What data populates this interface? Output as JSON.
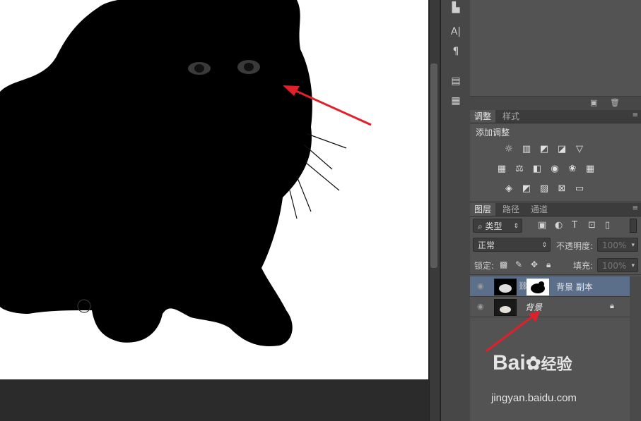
{
  "adjustments_panel": {
    "tabs": [
      "调整",
      "样式"
    ],
    "title": "添加调整"
  },
  "layers_panel": {
    "tabs": [
      "图层",
      "路径",
      "通道"
    ],
    "filter_kind": "类型",
    "blend_mode": "正常",
    "opacity_label": "不透明度:",
    "opacity_value": "100%",
    "lock_label": "锁定:",
    "fill_label": "填充:",
    "fill_value": "100%",
    "layers": [
      {
        "name": "背景 副本",
        "selected": true
      },
      {
        "name": "背景",
        "selected": false,
        "locked": true
      }
    ]
  },
  "toolstrip": {
    "icons": [
      "tool-preset-icon",
      "character-icon",
      "paragraph-icon",
      "paragraph-styles-icon",
      "notes-icon"
    ],
    "glyphs": [
      "A|",
      "¶"
    ]
  },
  "watermark": {
    "brand_text": "Bai",
    "brand_suffix": "经验",
    "url": "jingyan.baidu.com"
  },
  "colors": {
    "panel_bg": "#474747",
    "selected_layer": "#5b6e8a",
    "arrow_red": "#e0202a"
  }
}
